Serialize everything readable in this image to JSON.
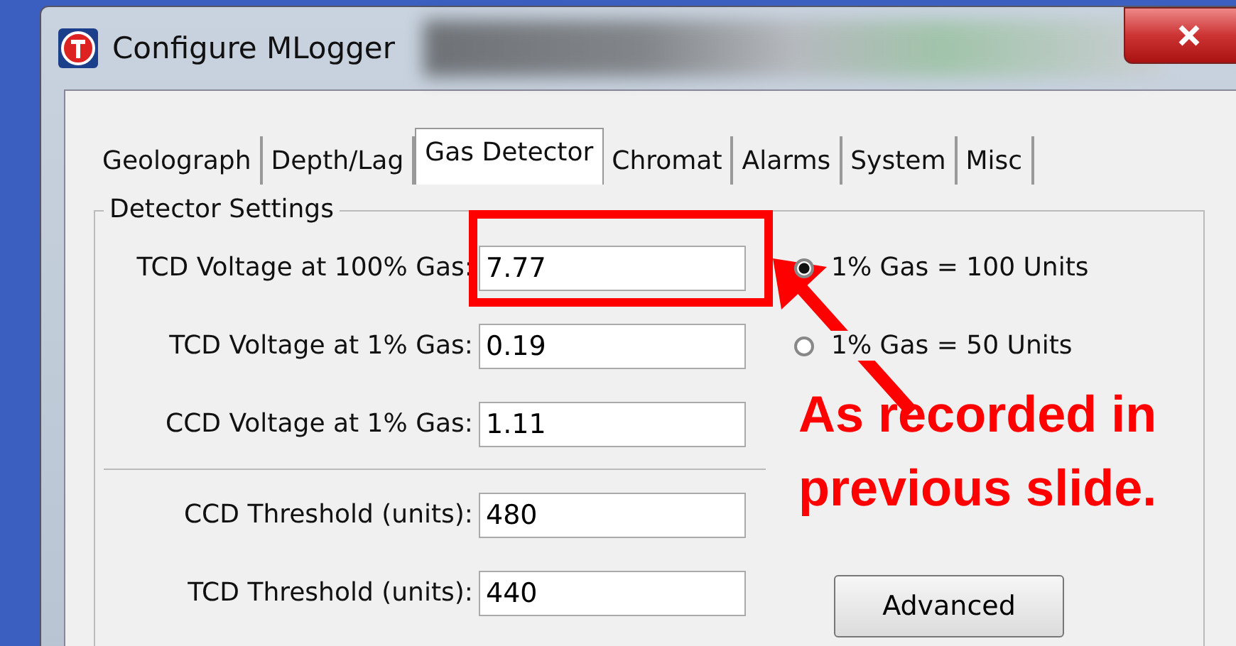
{
  "window": {
    "title": "Configure MLogger"
  },
  "tabs": [
    {
      "label": "Geolograph",
      "selected": false
    },
    {
      "label": "Depth/Lag",
      "selected": false
    },
    {
      "label": "Gas Detector",
      "selected": true
    },
    {
      "label": "Chromat",
      "selected": false
    },
    {
      "label": "Alarms",
      "selected": false
    },
    {
      "label": "System",
      "selected": false
    },
    {
      "label": "Misc",
      "selected": false
    }
  ],
  "group": {
    "title": "Detector Settings"
  },
  "fields": [
    {
      "label": "TCD Voltage at 100% Gas:",
      "value": "7.77"
    },
    {
      "label": "TCD Voltage at 1% Gas:",
      "value": "0.19"
    },
    {
      "label": "CCD Voltage at 1% Gas:",
      "value": "1.11"
    },
    {
      "label": "CCD Threshold (units):",
      "value": "480"
    },
    {
      "label": "TCD Threshold (units):",
      "value": "440"
    }
  ],
  "radios": [
    {
      "label": "1% Gas = 100 Units",
      "selected": true
    },
    {
      "label": "1% Gas = 50 Units",
      "selected": false
    }
  ],
  "buttons": [
    "Advanced"
  ],
  "annotation": {
    "lines": [
      "As recorded in",
      "previous slide."
    ]
  }
}
